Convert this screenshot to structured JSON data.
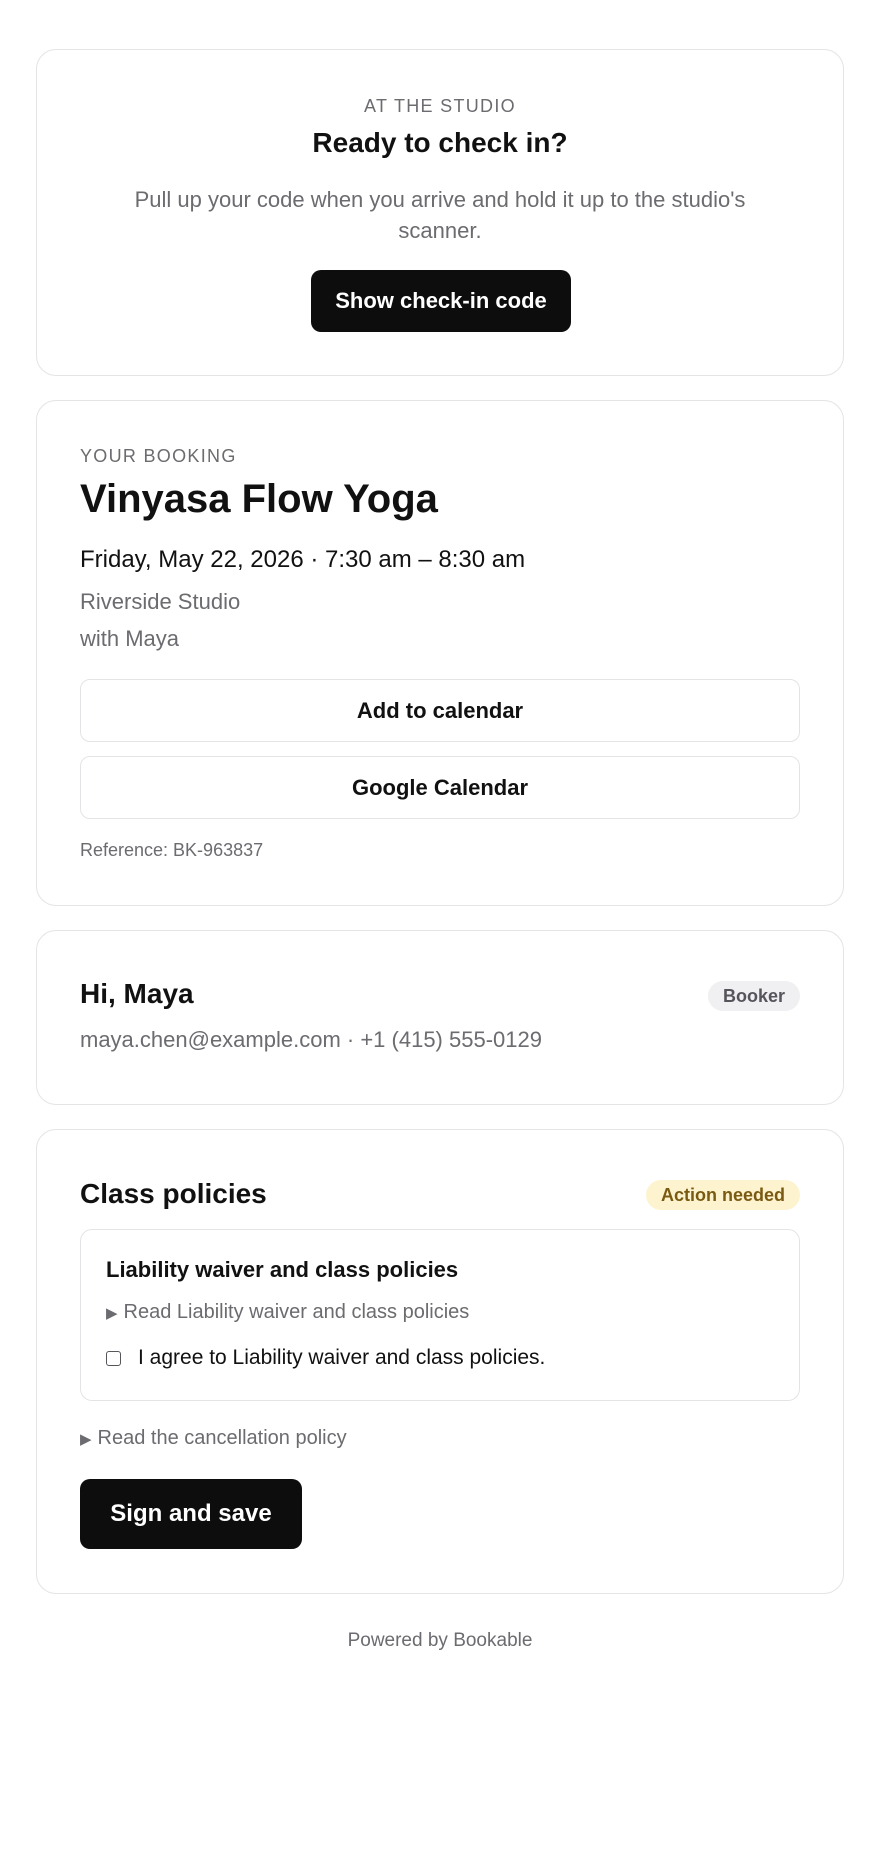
{
  "checkin": {
    "eyebrow": "AT THE STUDIO",
    "title": "Ready to check in?",
    "description": "Pull up your code when you arrive and hold it up to the studio's scanner.",
    "button_label": "Show check-in code"
  },
  "booking": {
    "eyebrow": "YOUR BOOKING",
    "class_name": "Vinyasa Flow Yoga",
    "datetime": "Friday, May 22, 2026 · 7:30 am – 8:30 am",
    "location": "Riverside Studio",
    "instructor": "with Maya",
    "add_calendar_label": "Add to calendar",
    "google_calendar_label": "Google Calendar",
    "reference": "Reference: BK-963837"
  },
  "contact": {
    "greeting": "Hi, Maya",
    "role_badge": "Booker",
    "details": "maya.chen@example.com · +1 (415) 555-0129"
  },
  "policies": {
    "title": "Class policies",
    "status_badge": "Action needed",
    "waiver": {
      "title": "Liability waiver and class policies",
      "read_link": "Read Liability waiver and class policies",
      "agree_label": "I agree to Liability waiver and class policies.",
      "agreed": false
    },
    "cancellation_link": "Read the cancellation policy",
    "sign_button_label": "Sign and save"
  },
  "footer": {
    "text": "Powered by Bookable"
  },
  "colors": {
    "primary_button": "#0d0d0d",
    "muted_text": "#6b6b70",
    "border": "#e4e4e6",
    "action_badge_bg": "#fdf4cf",
    "action_badge_text": "#7a5a12"
  }
}
